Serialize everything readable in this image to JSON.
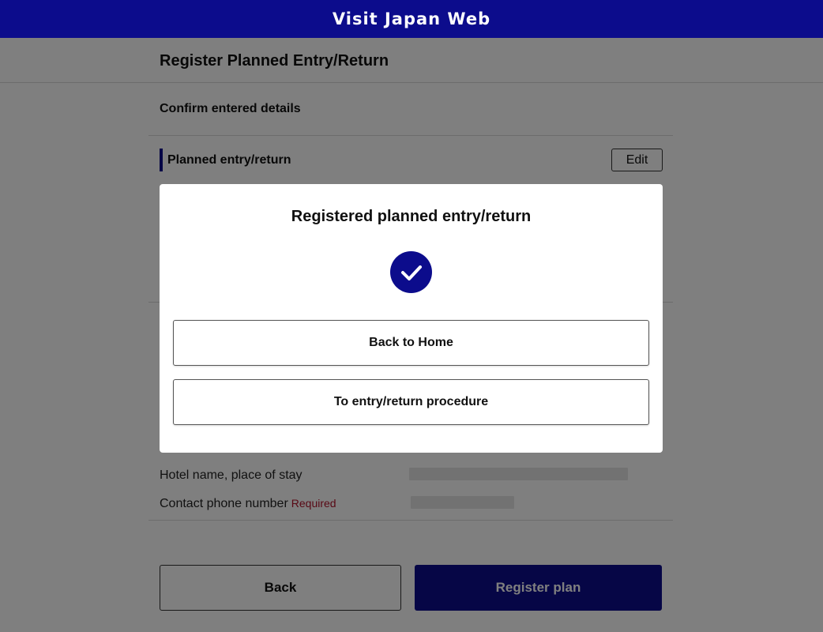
{
  "header": {
    "site_title": "Visit Japan Web"
  },
  "page": {
    "title": "Register Planned Entry/Return",
    "section_title": "Confirm entered details",
    "planned_header": "Planned entry/return",
    "edit_label": "Edit"
  },
  "details": {
    "hotel_label": "Hotel name, place of stay",
    "phone_label": "Contact phone number",
    "required_label": "Required"
  },
  "footer": {
    "back_label": "Back",
    "register_label": "Register plan"
  },
  "modal": {
    "title": "Registered planned entry/return",
    "icon": "check-circle-icon",
    "home_button": "Back to Home",
    "procedure_button": "To entry/return procedure"
  },
  "colors": {
    "brand": "#0c0c8c",
    "required": "#b0122a"
  }
}
